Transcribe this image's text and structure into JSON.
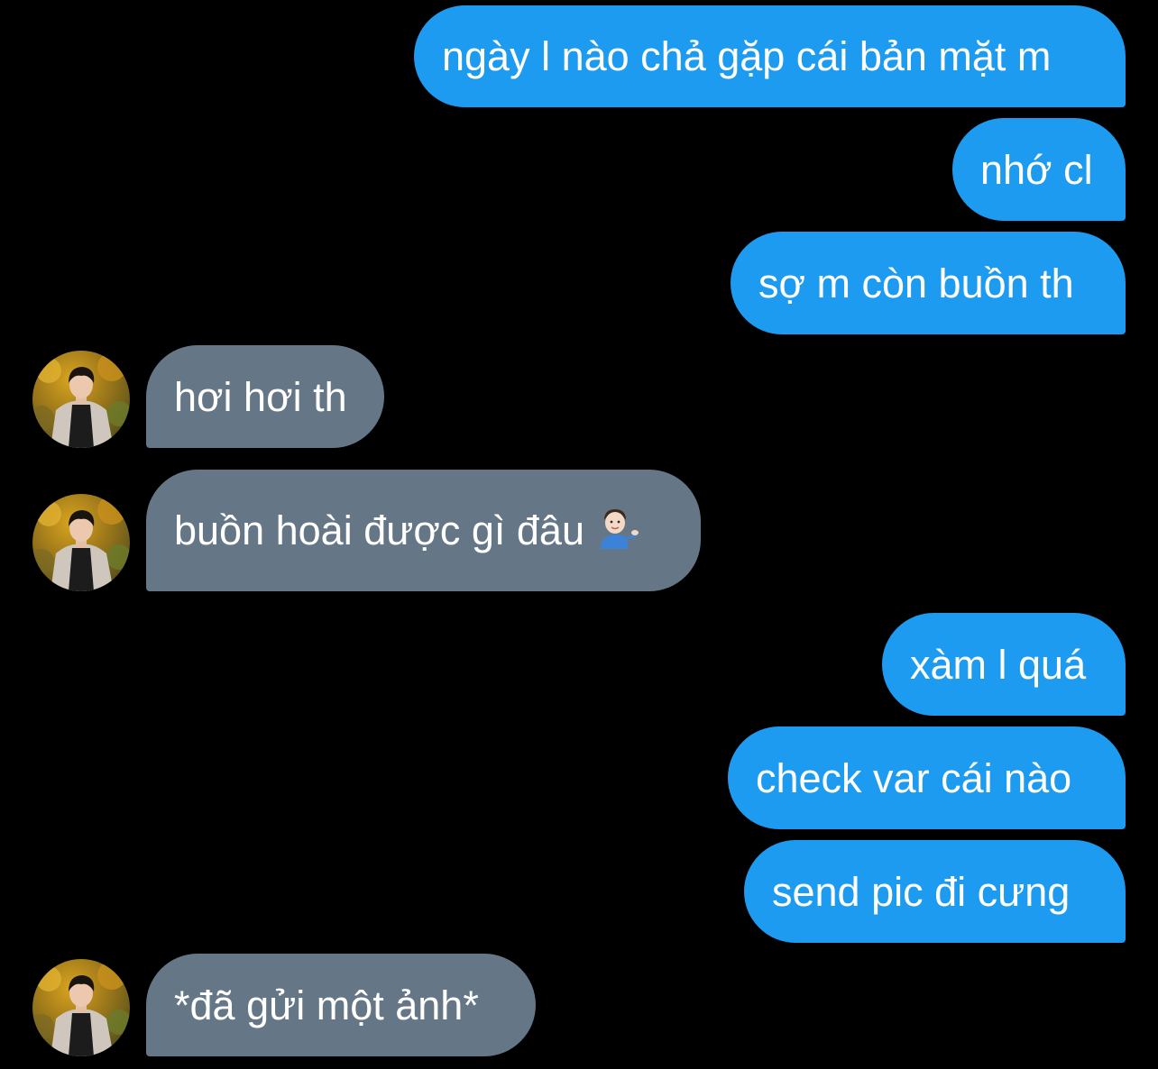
{
  "conversation": {
    "messages": [
      {
        "side": "sent",
        "text": "ngày l nào chả gặp cái bản mặt m"
      },
      {
        "side": "sent",
        "text": "nhớ cl"
      },
      {
        "side": "sent",
        "text": "sợ m còn buồn th"
      },
      {
        "side": "received",
        "text": "hơi hơi th"
      },
      {
        "side": "received",
        "text": "buồn hoài được gì đâu",
        "emoji": "person-tipping-hand-emoji"
      },
      {
        "side": "sent",
        "text": "xàm l quá"
      },
      {
        "side": "sent",
        "text": "check var cái nào"
      },
      {
        "side": "sent",
        "text": "send pic đi cưng"
      },
      {
        "side": "received",
        "text": "*đã gửi một ảnh*"
      }
    ],
    "avatar_icon": "user-avatar-photo",
    "colors": {
      "background": "#000000",
      "sent_bubble": "#1d9bf0",
      "received_bubble": "#657786",
      "text": "#ffffff"
    }
  }
}
